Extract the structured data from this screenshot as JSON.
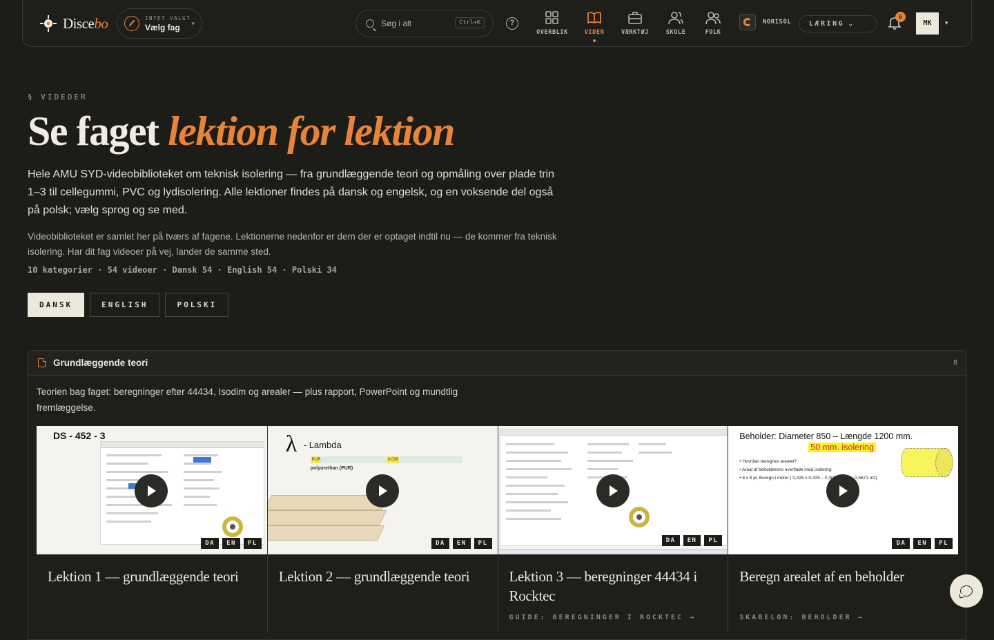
{
  "nav": {
    "brand_main": "Disce",
    "brand_em": "bo",
    "fag_small": "INTET VALGT",
    "fag_big": "Vælg fag",
    "search_placeholder": "Søg i alt",
    "search_kbd": "Ctrl+K",
    "help": "?",
    "items": [
      {
        "label": "OVERBLIK",
        "icon": "grid-icon",
        "active": false
      },
      {
        "label": "VIDEN",
        "icon": "book-icon",
        "active": true
      },
      {
        "label": "VÆRKTØJ",
        "icon": "toolbox-icon",
        "active": false
      },
      {
        "label": "SKOLE",
        "icon": "users-icon",
        "active": false
      },
      {
        "label": "FOLK",
        "icon": "people-icon",
        "active": false
      }
    ],
    "org": "NORISOL",
    "mode": "LÆRING",
    "notifications": "6",
    "avatar": "MK"
  },
  "hero": {
    "eyebrow": "§ VIDEOER",
    "title_plain": "Se faget ",
    "title_em": "lektion for lektion",
    "lead": "Hele AMU SYD-videobiblioteket om teknisk isolering — fra grundlæggende teori og opmåling over plade trin 1–3 til cellegummi, PVC og lydisolering. Alle lektioner findes på dansk og engelsk, og en voksende del også på polsk; vælg sprog og se med.",
    "sub": "Videobiblioteket er samlet her på tværs af fagene. Lektionerne nedenfor er dem der er optaget indtil nu — de kommer fra teknisk isolering. Har dit fag videoer på vej, lander de samme sted.",
    "stats": "10 kategorier · 54 videoer · Dansk 54 · English 54 · Polski 34",
    "languages": [
      {
        "label": "DANSK",
        "active": true
      },
      {
        "label": "ENGLISH",
        "active": false
      },
      {
        "label": "POLSKI",
        "active": false
      }
    ]
  },
  "section": {
    "title": "Grundlæggende teori",
    "count": "8",
    "desc": "Teorien bag faget: beregninger efter 44434, Isodim og arealer — plus rapport, PowerPoint og mundtlig fremlæggelse.",
    "cards": [
      {
        "title": "Lektion 1 — grundlæggende teori",
        "link": "",
        "tags": [
          "DA",
          "EN",
          "PL"
        ]
      },
      {
        "title": "Lektion 2 — grundlæggende teori",
        "link": "",
        "tags": [
          "DA",
          "EN",
          "PL"
        ]
      },
      {
        "title": "Lektion 3 — beregninger 44434 i Rocktec",
        "link": "GUIDE: BEREGNINGER I ROCKTEC →",
        "tags": [
          "DA",
          "EN",
          "PL"
        ]
      },
      {
        "title": "Beregn arealet af en beholder",
        "link": "SKABELON: BEHOLDER →",
        "tags": [
          "DA",
          "EN",
          "PL"
        ]
      }
    ]
  },
  "thumbs": {
    "t1_title": "DS - 452 - 3",
    "t2_lambda": "λ",
    "t2_label": "- Lambda",
    "t2_bar_a": "PUR",
    "t2_bar_b": "0,026",
    "t2_pur": "polyurethan (PUR)",
    "t4_title": "Beholder: Diameter 850 – Længde 1200 mm.",
    "t4_highlight": "50 mm. isolering",
    "t4_b1": "• Hvordan beregnes arealet?",
    "t4_b2": "• Areal af beholderens overflade med isolering:",
    "t4_b3": "• 8 x 8 pl. Beregn i meter ( 0,425 x 0,425 – 0,306 x 3,14 – 0,5671 m2)"
  },
  "colors": {
    "accent": "#e8843a",
    "bg": "#1c1c19",
    "ink": "#ece7dc"
  }
}
